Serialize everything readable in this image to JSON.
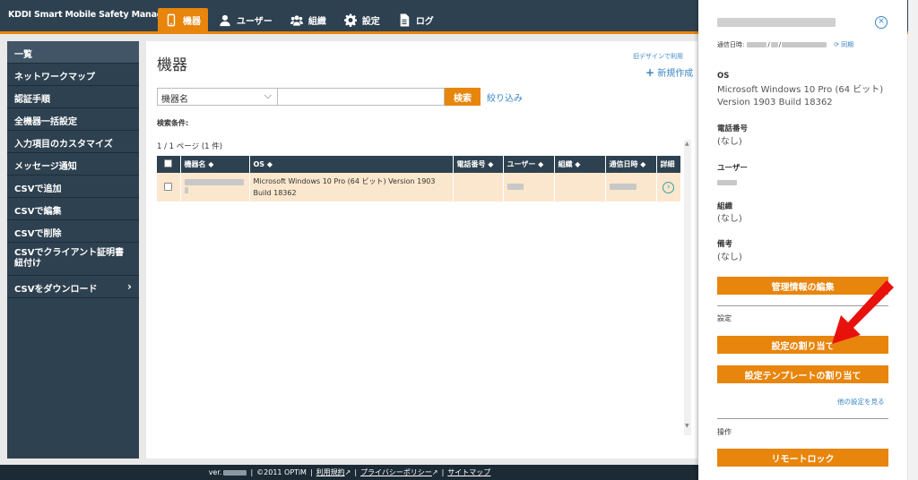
{
  "header": {
    "brand": "KDDI Smart Mobile Safety Manager",
    "nav": [
      {
        "label": "機器",
        "icon": "phone-icon",
        "active": true
      },
      {
        "label": "ユーザー",
        "icon": "user-icon",
        "active": false
      },
      {
        "label": "組織",
        "icon": "group-icon",
        "active": false
      },
      {
        "label": "設定",
        "icon": "gear-icon",
        "active": false
      },
      {
        "label": "ログ",
        "icon": "document-icon",
        "active": false
      }
    ]
  },
  "sidebar": {
    "items": [
      {
        "label": "一覧"
      },
      {
        "label": "ネットワークマップ"
      },
      {
        "label": "認証手順"
      },
      {
        "label": "全機器一括設定"
      },
      {
        "label": "入力項目のカスタマイズ"
      },
      {
        "label": "メッセージ通知"
      },
      {
        "label": "CSVで追加"
      },
      {
        "label": "CSVで編集"
      },
      {
        "label": "CSVで削除"
      },
      {
        "label": "CSVでクライアント証明書紐付け"
      },
      {
        "label": "CSVをダウンロード",
        "chevron": "›"
      }
    ]
  },
  "main": {
    "title": "機器",
    "old_design": "旧デザインで利用",
    "new_create": "新規作成",
    "new_create_icon": "+",
    "search": {
      "field_select": "機器名",
      "dropdown_icon": "⌵",
      "button": "検索",
      "filter": "絞り込み"
    },
    "conditions": "検索条件:",
    "pager": "1 / 1 ページ (1 件)",
    "table": {
      "headers": [
        "機器名 ◆",
        "OS ◆",
        "電話番号 ◆",
        "ユーザー ◆",
        "組織 ◆",
        "通信日時 ◆",
        "詳細"
      ],
      "row": {
        "os": "Microsoft Windows 10 Pro (64 ビット) Version 1903 Build 18362",
        "detail_icon": "›"
      }
    }
  },
  "footer": {
    "version": "ver.",
    "copyright": "©2011 OPTiM",
    "terms": "利用規約",
    "privacy": "プライバシーポリシー",
    "sitemap": "サイトマップ",
    "separator": "|"
  },
  "panel": {
    "close_icon": "×",
    "comm_label": "通信日時:",
    "sync": "⟳ 同期",
    "os_label": "OS",
    "os_value": "Microsoft Windows 10 Pro (64 ビット) Version 1903 Build 18362",
    "phone_label": "電話番号",
    "phone_value": "(なし)",
    "user_label": "ユーザー",
    "org_label": "組織",
    "org_value": "(なし)",
    "note_label": "備考",
    "note_value": "(なし)",
    "edit_button": "管理情報の編集",
    "settings_label": "設定",
    "assign_button": "設定の割り当て",
    "template_button": "設定テンプレートの割り当て",
    "other_settings": "他の設定を見る",
    "ops_label": "操作",
    "remote_lock": "リモートロック"
  },
  "colors": {
    "accent": "#e8850c",
    "navy": "#2e4150",
    "link": "#3a86c4",
    "row_highlight": "#fbe7cd",
    "arrow": "#e8120c"
  }
}
